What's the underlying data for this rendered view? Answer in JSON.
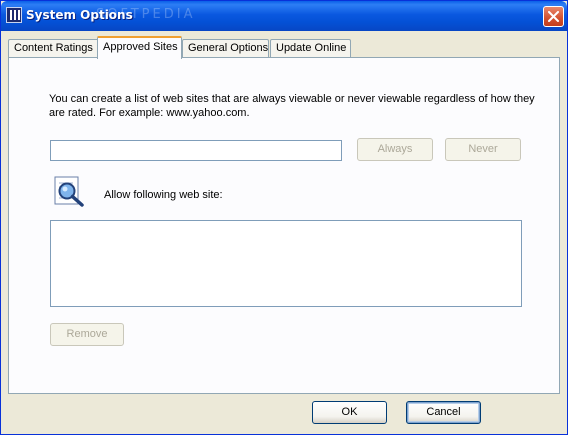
{
  "window": {
    "title": "System Options",
    "app_icon": "app-icon",
    "close_icon": "close-icon"
  },
  "tabs": [
    {
      "label": "Content Ratings",
      "active": false
    },
    {
      "label": "Approved Sites",
      "active": true
    },
    {
      "label": "General Options",
      "active": false
    },
    {
      "label": "Update Online",
      "active": false
    }
  ],
  "approved_sites": {
    "description": "You can create a list of web sites that are always viewable or never viewable regardless of how they are rated. For example: www.yahoo.com.",
    "url_input_value": "",
    "always_label": "Always",
    "never_label": "Never",
    "allow_label": "Allow following web site:",
    "sites": [],
    "remove_label": "Remove",
    "list_icon": "magnifier-icon"
  },
  "footer": {
    "ok_label": "OK",
    "cancel_label": "Cancel"
  },
  "watermark": "SOFTPEDIA"
}
